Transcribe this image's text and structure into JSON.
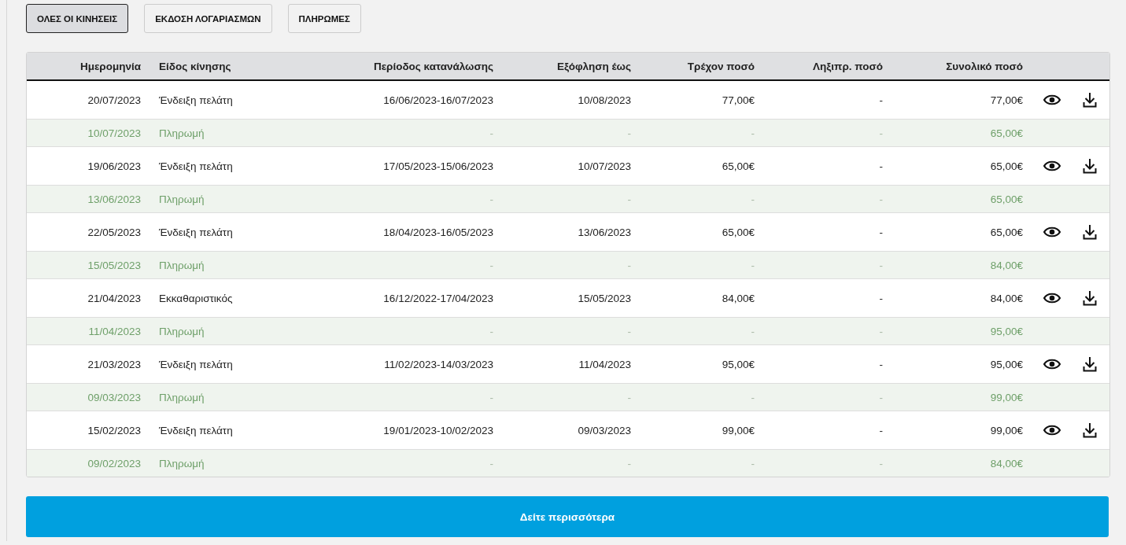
{
  "tabs": [
    {
      "label": "ΟΛΕΣ ΟΙ ΚΙΝΗΣΕΙΣ",
      "selected": true
    },
    {
      "label": "ΕΚΔΟΣΗ ΛΟΓΑΡΙΑΣΜΩΝ",
      "selected": false
    },
    {
      "label": "ΠΛΗΡΩΜΕΣ",
      "selected": false
    }
  ],
  "table": {
    "columns": [
      "Ημερομηνία",
      "Είδος κίνησης",
      "Περίοδος κατανάλωσης",
      "Εξόφληση έως",
      "Τρέχον ποσό",
      "Ληξιπρ. ποσό",
      "Συνολικό ποσό"
    ],
    "rows": [
      {
        "kind": "bill",
        "cells": [
          "20/07/2023",
          "Ένδειξη πελάτη",
          "16/06/2023-16/07/2023",
          "10/08/2023",
          "77,00€",
          "-",
          "77,00€"
        ]
      },
      {
        "kind": "payment",
        "cells": [
          "10/07/2023",
          "Πληρωμή",
          "-",
          "-",
          "-",
          "-",
          "65,00€"
        ]
      },
      {
        "kind": "bill",
        "cells": [
          "19/06/2023",
          "Ένδειξη πελάτη",
          "17/05/2023-15/06/2023",
          "10/07/2023",
          "65,00€",
          "-",
          "65,00€"
        ]
      },
      {
        "kind": "payment",
        "cells": [
          "13/06/2023",
          "Πληρωμή",
          "-",
          "-",
          "-",
          "-",
          "65,00€"
        ]
      },
      {
        "kind": "bill",
        "cells": [
          "22/05/2023",
          "Ένδειξη πελάτη",
          "18/04/2023-16/05/2023",
          "13/06/2023",
          "65,00€",
          "-",
          "65,00€"
        ]
      },
      {
        "kind": "payment",
        "cells": [
          "15/05/2023",
          "Πληρωμή",
          "-",
          "-",
          "-",
          "-",
          "84,00€"
        ]
      },
      {
        "kind": "bill",
        "cells": [
          "21/04/2023",
          "Εκκαθαριστικός",
          "16/12/2022-17/04/2023",
          "15/05/2023",
          "84,00€",
          "-",
          "84,00€"
        ]
      },
      {
        "kind": "payment",
        "cells": [
          "11/04/2023",
          "Πληρωμή",
          "-",
          "-",
          "-",
          "-",
          "95,00€"
        ]
      },
      {
        "kind": "bill",
        "cells": [
          "21/03/2023",
          "Ένδειξη πελάτη",
          "11/02/2023-14/03/2023",
          "11/04/2023",
          "95,00€",
          "-",
          "95,00€"
        ]
      },
      {
        "kind": "payment",
        "cells": [
          "09/03/2023",
          "Πληρωμή",
          "-",
          "-",
          "-",
          "-",
          "99,00€"
        ]
      },
      {
        "kind": "bill",
        "cells": [
          "15/02/2023",
          "Ένδειξη πελάτη",
          "19/01/2023-10/02/2023",
          "09/03/2023",
          "99,00€",
          "-",
          "99,00€"
        ]
      },
      {
        "kind": "payment",
        "cells": [
          "09/02/2023",
          "Πληρωμή",
          "-",
          "-",
          "-",
          "-",
          "84,00€"
        ]
      }
    ]
  },
  "more_button": "Δείτε περισσότερα"
}
